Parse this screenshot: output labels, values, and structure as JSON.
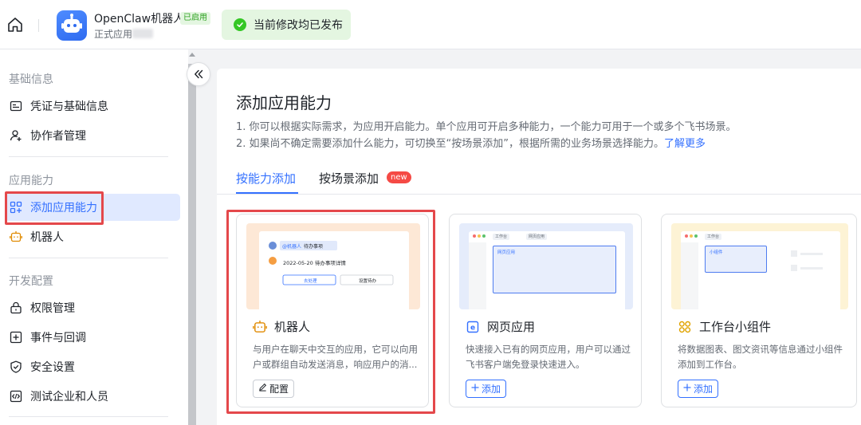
{
  "topbar": {
    "app_name": "OpenClaw机器人",
    "app_status": "已启用",
    "app_type": "正式应用",
    "publish_message": "当前修改均已发布"
  },
  "sidebar": {
    "groups": [
      "基础信息",
      "应用能力",
      "开发配置"
    ],
    "items": [
      {
        "label": "凭证与基础信息",
        "icon": "id-card-icon"
      },
      {
        "label": "协作者管理",
        "icon": "user-add-icon"
      },
      {
        "label": "添加应用能力",
        "icon": "grid-plus-icon",
        "active": true
      },
      {
        "label": "机器人",
        "icon": "robot-icon"
      },
      {
        "label": "权限管理",
        "icon": "lock-icon"
      },
      {
        "label": "事件与回调",
        "icon": "plus-box-icon"
      },
      {
        "label": "安全设置",
        "icon": "shield-icon"
      },
      {
        "label": "测试企业和人员",
        "icon": "code-box-icon"
      }
    ]
  },
  "main": {
    "title": "添加应用能力",
    "desc1": "1. 你可以根据实际需求，为应用开启能力。单个应用可开启多种能力，一个能力可用于一个或多个飞书场景。",
    "desc2": "2. 如果尚不确定需要添加什么能力，可切换至“按场景添加”，根据所需的业务场景选择能力。",
    "learn_more": "了解更多",
    "tabs": [
      {
        "label": "按能力添加",
        "active": true
      },
      {
        "label": "按场景添加",
        "badge": "new"
      }
    ],
    "cards": [
      {
        "title": "机器人",
        "icon": "robot-icon",
        "desc": "与用户在聊天中交互的应用，它可以向用户或群组自动发送消息，响应用户的消...",
        "button": "配置",
        "button_icon": "edit-icon",
        "preview": {
          "bot_tag": "@机器人",
          "bot_msg": "待办事项",
          "line": "2022-05-20 待办事项详情",
          "btn_a": "去处理",
          "btn_b": "设置待办"
        }
      },
      {
        "title": "网页应用",
        "icon": "web-app-icon",
        "desc": "快速接入已有的网页应用，用户可以通过飞书客户端免登录快速进入。",
        "button": "添加",
        "button_icon": "plus-icon",
        "preview": {
          "tab_a": "工作台",
          "tab_b": "网页应用",
          "frame_label": "网页应用"
        }
      },
      {
        "title": "工作台小组件",
        "icon": "widget-icon",
        "desc": "将数据图表、图文资讯等信息通过小组件添加到工作台。",
        "button": "添加",
        "button_icon": "plus-icon",
        "preview": {
          "tab_a": "工作台",
          "frame_label": "小组件"
        }
      }
    ]
  },
  "colors": {
    "accent": "#3370ff",
    "highlight": "#e4484b",
    "success": "#34c724"
  }
}
